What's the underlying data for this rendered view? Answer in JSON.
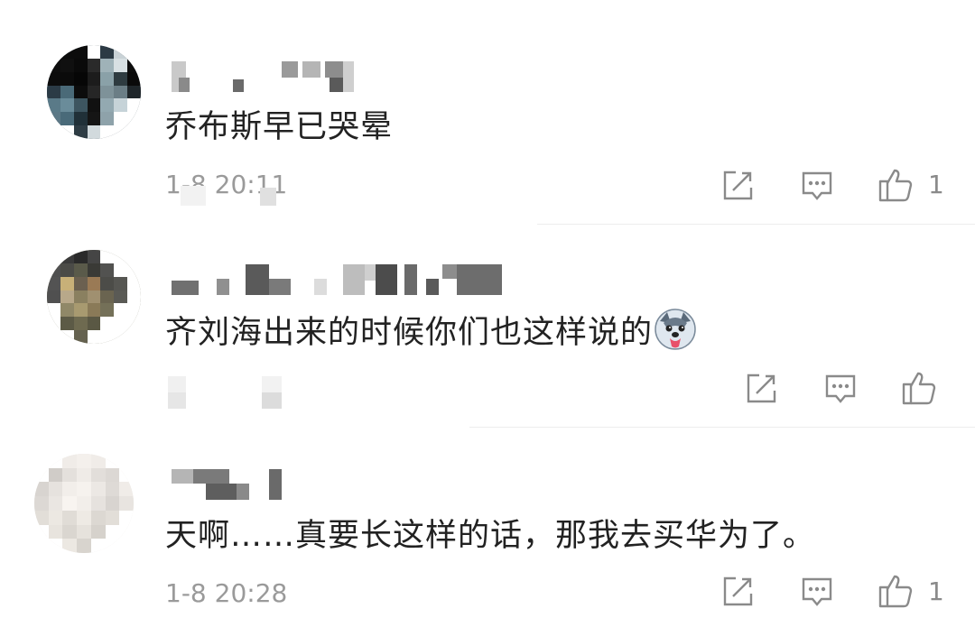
{
  "comments": [
    {
      "text": "乔布斯早已哭晕",
      "time": "1-8 20:11",
      "likes": "1"
    },
    {
      "text": "齐刘海出来的时候你们也这样说的",
      "emoji": "husky-dog-emoji",
      "time": "1-8 20:13",
      "likes": ""
    },
    {
      "text": "天啊……真要长这样的话，那我去买华为了。",
      "time": "1-8 20:28",
      "likes": "1"
    }
  ],
  "icons": {
    "share": "share-icon",
    "reply": "comment-icon",
    "like": "thumbs-up-icon"
  },
  "colors": {
    "text": "#222222",
    "meta": "#9a9a9a",
    "icon": "#8a8a8a",
    "divider": "#ededed"
  }
}
